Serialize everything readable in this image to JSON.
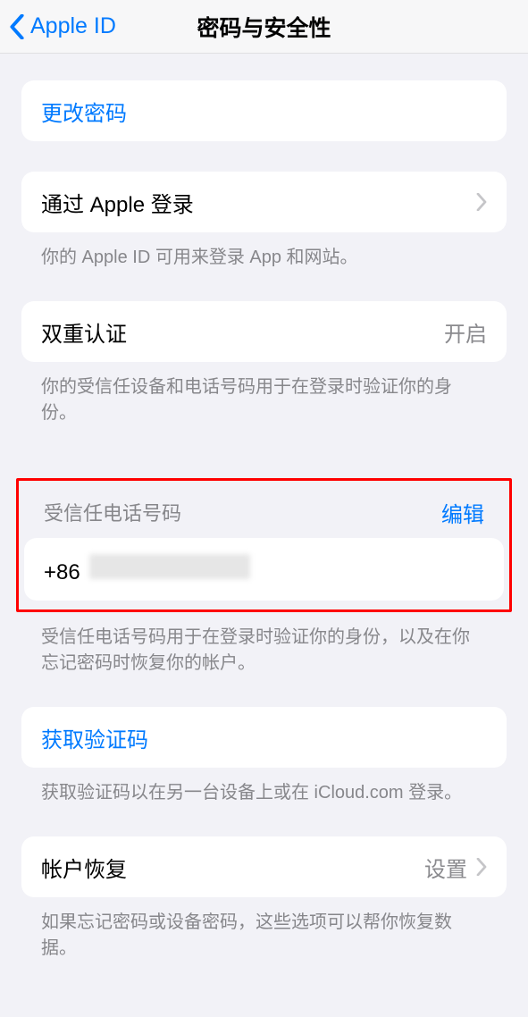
{
  "header": {
    "back_label": "Apple ID",
    "title": "密码与安全性"
  },
  "change_password": {
    "label": "更改密码"
  },
  "sign_in_with_apple": {
    "label": "通过 Apple 登录",
    "footer": "你的 Apple ID 可用来登录 App 和网站。"
  },
  "two_factor": {
    "label": "双重认证",
    "value": "开启",
    "footer": "你的受信任设备和电话号码用于在登录时验证你的身份。"
  },
  "trusted_phone": {
    "header_label": "受信任电话号码",
    "edit_label": "编辑",
    "country_code": "+86",
    "footer": "受信任电话号码用于在登录时验证你的身份，以及在你忘记密码时恢复你的帐户。"
  },
  "get_code": {
    "label": "获取验证码",
    "footer": "获取验证码以在另一台设备上或在 iCloud.com 登录。"
  },
  "account_recovery": {
    "label": "帐户恢复",
    "value": "设置",
    "footer": "如果忘记密码或设备密码，这些选项可以帮你恢复数据。"
  }
}
